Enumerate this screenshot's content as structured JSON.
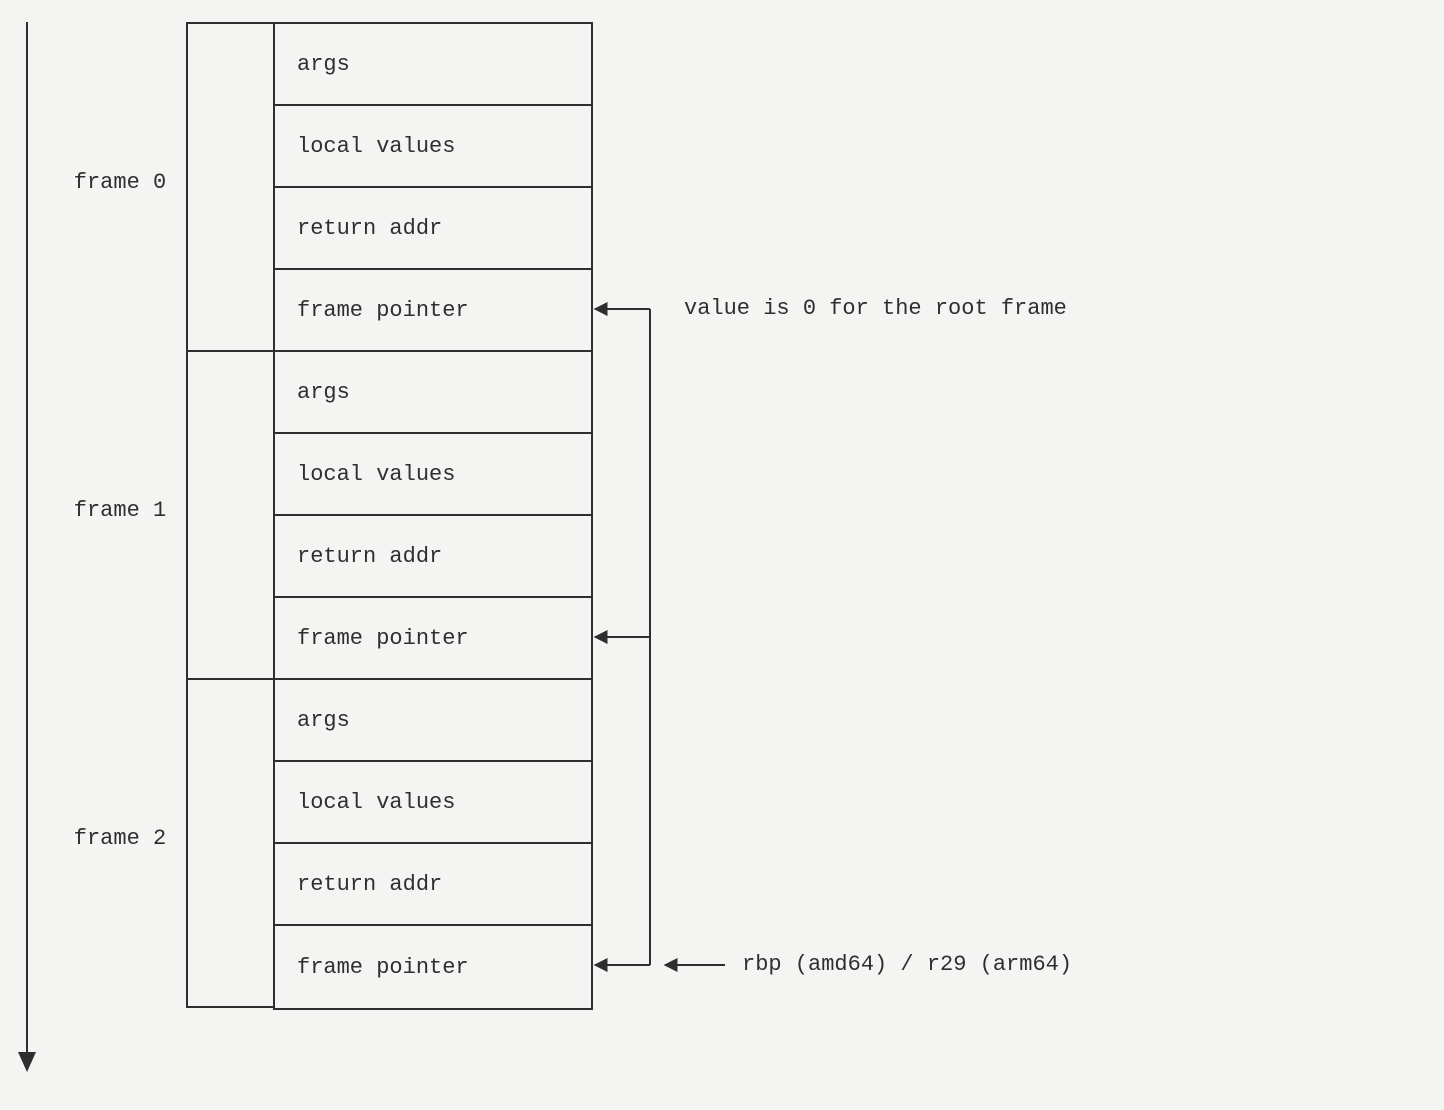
{
  "frames": [
    {
      "label": "frame 0",
      "cells": [
        "args",
        "local values",
        "return addr",
        "frame pointer"
      ]
    },
    {
      "label": "frame 1",
      "cells": [
        "args",
        "local values",
        "return addr",
        "frame pointer"
      ]
    },
    {
      "label": "frame 2",
      "cells": [
        "args",
        "local values",
        "return addr",
        "frame pointer"
      ]
    }
  ],
  "annotations": {
    "root_note": "value is 0 for the root frame",
    "register_note": "rbp (amd64) / r29 (arm64)"
  }
}
